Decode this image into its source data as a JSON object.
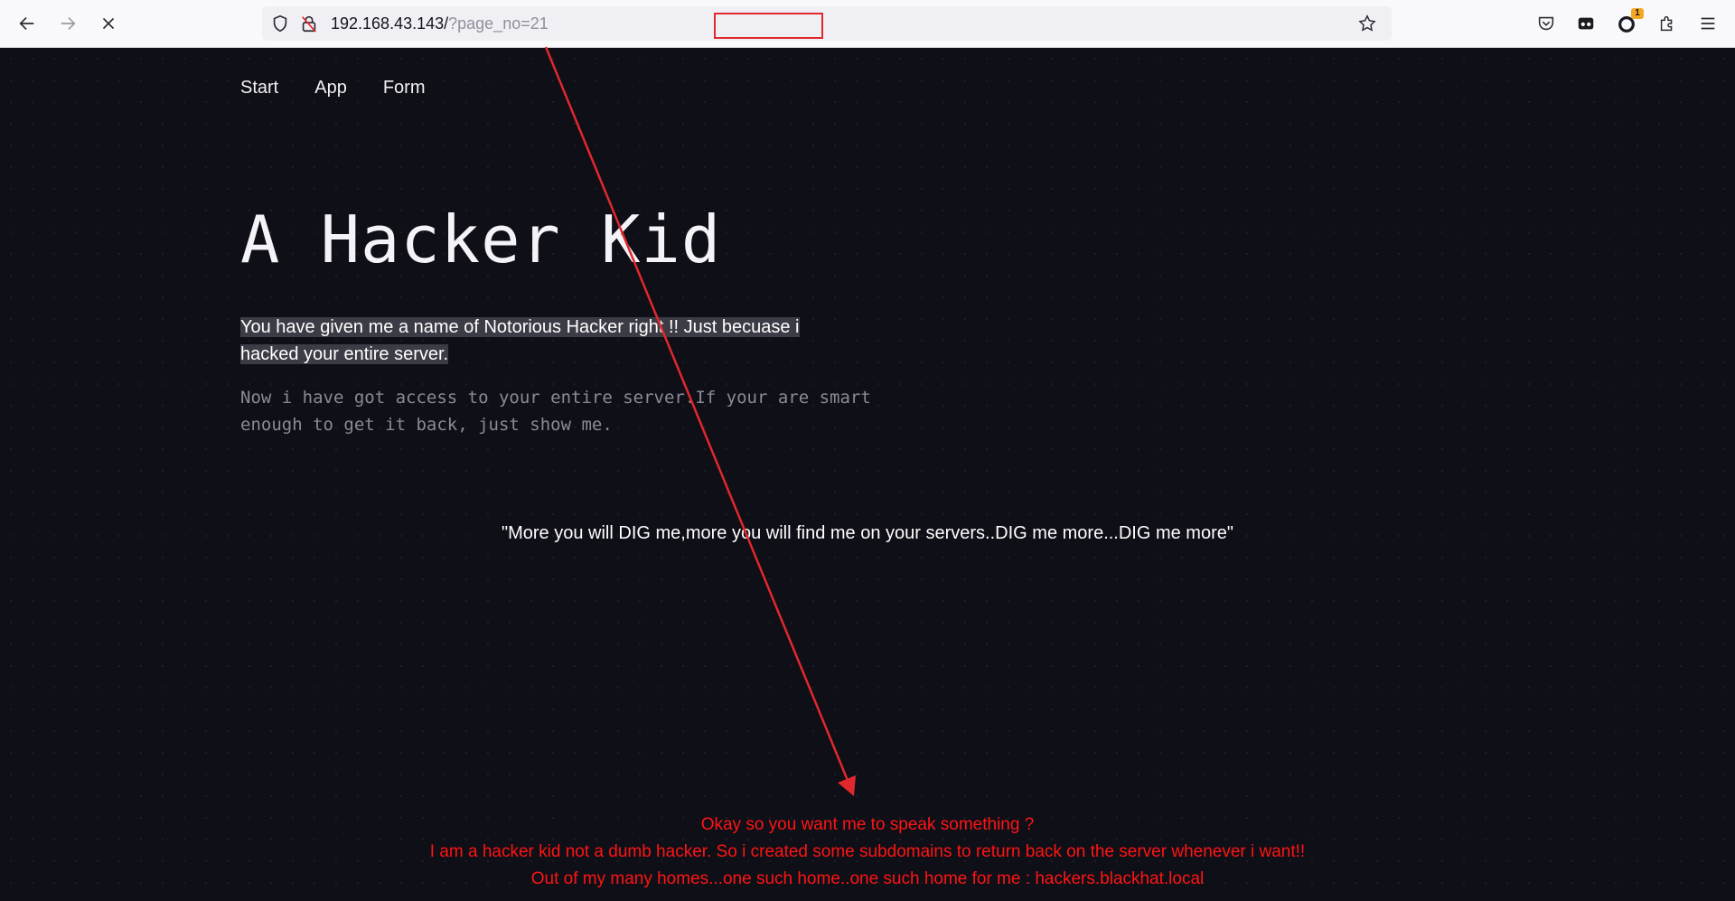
{
  "browser": {
    "url_host": "192.168.43.143/",
    "url_query": "?page_no=21",
    "extension_badge": "1"
  },
  "nav": {
    "items": [
      "Start",
      "App",
      "Form"
    ]
  },
  "hero": {
    "title": "A Hacker Kid",
    "lead": "You have given me a name of Notorious Hacker right !! Just becuase i hacked your entire server.",
    "sub": "Now i have got access to your entire server.If your are smart enough to get it back, just show me."
  },
  "quote": "\"More you will DIG me,more you will find me on your servers..DIG me more...DIG me more\"",
  "message": {
    "line1": "Okay so you want me to speak something ?",
    "line2": "I am a hacker kid not a dumb hacker. So i created some subdomains to return back on the server whenever i want!!",
    "line3": "Out of my many homes...one such home..one such home for me : hackers.blackhat.local"
  },
  "colors": {
    "page_bg": "#0f0f17",
    "message": "#ff1414",
    "annotation": "#e0282e"
  }
}
